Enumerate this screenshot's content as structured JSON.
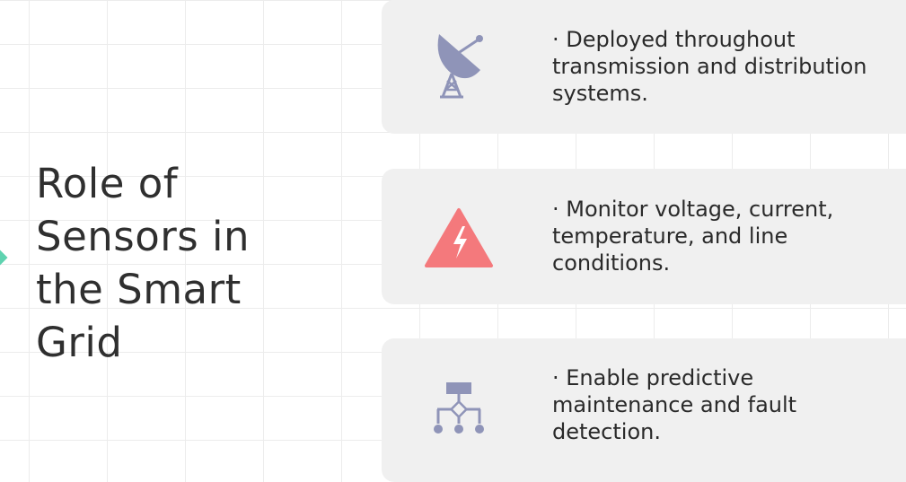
{
  "title": "Role of Sensors in the Smart Grid",
  "colors": {
    "accent": "#5fd3b0",
    "icon_slate": "#8f94b8",
    "icon_alert": "#f4797c",
    "card_background": "#f0f0f0",
    "text": "#2f2f2f"
  },
  "cards": [
    {
      "icon": "satellite-dish-icon",
      "text": "· Deployed throughout transmission and distribution systems."
    },
    {
      "icon": "high-voltage-warning-icon",
      "text": "· Monitor voltage, current, temperature, and line conditions."
    },
    {
      "icon": "network-hierarchy-icon",
      "text": "· Enable predictive maintenance and fault detection."
    }
  ]
}
